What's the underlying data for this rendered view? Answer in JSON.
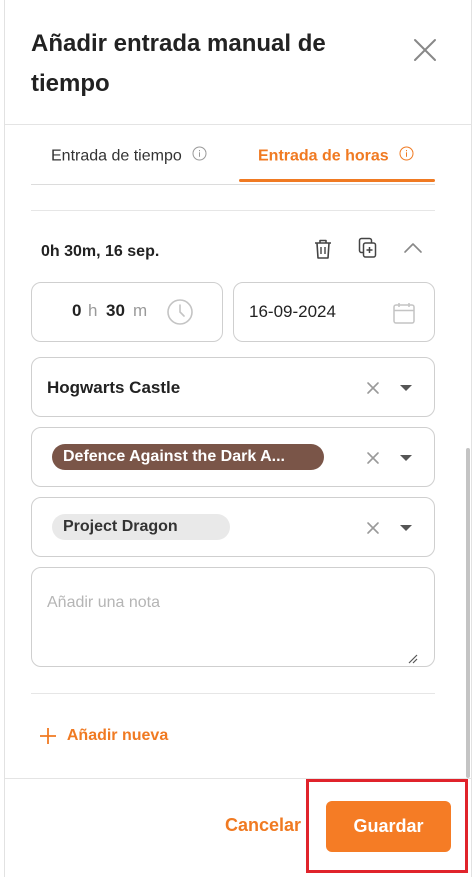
{
  "modal": {
    "title": "Añadir entrada manual de tiempo",
    "tabs": [
      {
        "label": "Entrada de tiempo",
        "active": false
      },
      {
        "label": "Entrada de horas",
        "active": true
      }
    ]
  },
  "entry": {
    "summary": "0h 30m, 16 sep.",
    "duration": {
      "hours": "0",
      "hours_unit": "h",
      "minutes": "30",
      "minutes_unit": "m"
    },
    "date": "16-09-2024",
    "location": "Hogwarts Castle",
    "class_tag": "Defence Against the Dark A...",
    "project_tag": "Project Dragon",
    "note_placeholder": "Añadir una nota"
  },
  "actions": {
    "add_new": "Añadir nueva",
    "cancel": "Cancelar",
    "save": "Guardar"
  },
  "colors": {
    "accent": "#f57c25",
    "chip_dark": "#7a5548",
    "highlight": "#e0232b"
  },
  "icons": [
    "close-icon",
    "info-icon",
    "trash-icon",
    "duplicate-icon",
    "chevron-up-icon",
    "clock-icon",
    "calendar-icon",
    "clear-icon",
    "caret-down-icon",
    "plus-icon",
    "resize-handle-icon"
  ]
}
